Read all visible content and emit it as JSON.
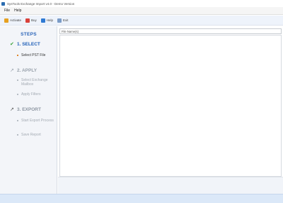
{
  "window": {
    "title": "SysTools Exchange Import v4.0 - Demo Version"
  },
  "menu": {
    "items": [
      "File",
      "Help"
    ]
  },
  "toolbar": {
    "items": [
      {
        "label": "Activate",
        "icon": "cart-icon"
      },
      {
        "label": "Buy",
        "icon": "buy-icon"
      },
      {
        "label": "Help",
        "icon": "help-icon"
      },
      {
        "label": "Exit",
        "icon": "exit-icon"
      }
    ]
  },
  "sidebar": {
    "heading": "STEPS",
    "steps": [
      {
        "label": "1. SELECT",
        "mark": "✔",
        "subs": [
          "Select PST File"
        ]
      },
      {
        "label": "2. APPLY",
        "mark": "↗",
        "subs": [
          "Select Exchange Mailbox",
          "Apply Filters"
        ]
      },
      {
        "label": "3. EXPORT",
        "mark": "↗",
        "subs": [
          "Start Export Process",
          "Save Report"
        ]
      }
    ]
  },
  "main": {
    "path_placeholder": "File Name(s)"
  }
}
